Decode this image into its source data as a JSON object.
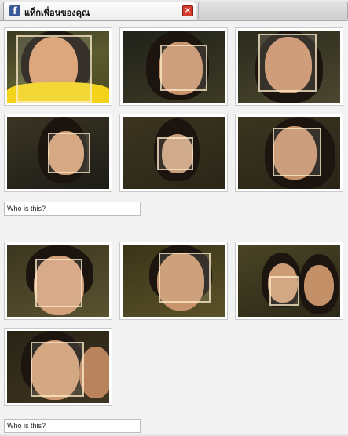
{
  "tab": {
    "title": "แท็กเพื่อนของคุณ",
    "icon": "facebook-icon",
    "close_label": "×"
  },
  "groups": [
    {
      "who_placeholder": "Who is this?"
    },
    {
      "who_placeholder": "Who is this?"
    }
  ],
  "colors": {
    "facebook": "#3b5998",
    "close": "#d33c2c"
  }
}
